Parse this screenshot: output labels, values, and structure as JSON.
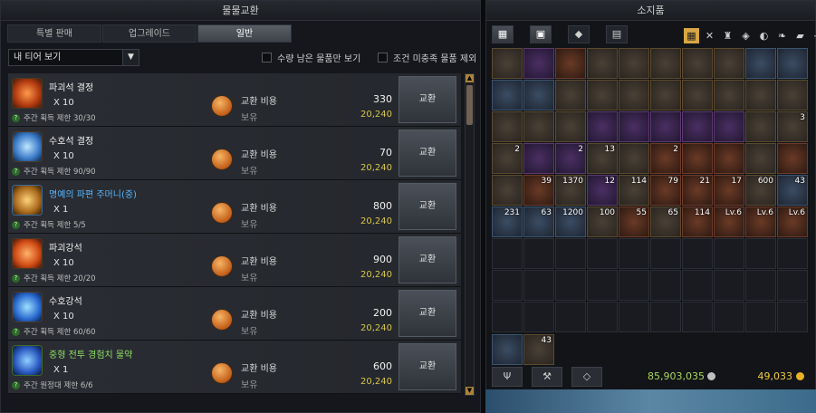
{
  "left_window": {
    "title": "물물교환",
    "tabs": [
      "특별 판매",
      "업그레이드",
      "일반"
    ],
    "active_tab": 2,
    "filter_select": "내 티어 보기",
    "checkbox1": "수량 남은 물품만 보기",
    "checkbox2": "조건 미충족 물품 제외",
    "cost_label": "교환 비용",
    "own_label": "보유",
    "exchange_button": "교환",
    "rows": [
      {
        "name": "파괴석 결정",
        "qty": "X 10",
        "limit": "주간 획득 제한 30/30",
        "cost": "330",
        "own": "20,240",
        "color": "normal"
      },
      {
        "name": "수호석 결정",
        "qty": "X 10",
        "limit": "주간 획득 제한 90/90",
        "cost": "70",
        "own": "20,240",
        "color": "normal"
      },
      {
        "name": "명예의 파편 주머니(중)",
        "qty": "X 1",
        "limit": "주간 획득 제한 5/5",
        "cost": "800",
        "own": "20,240",
        "color": "blue"
      },
      {
        "name": "파괴강석",
        "qty": "X 10",
        "limit": "주간 획득 제한 20/20",
        "cost": "900",
        "own": "20,240",
        "color": "normal"
      },
      {
        "name": "수호강석",
        "qty": "X 10",
        "limit": "주간 획득 제한 60/60",
        "cost": "200",
        "own": "20,240",
        "color": "normal"
      },
      {
        "name": "중형 전투 경험치 물약",
        "qty": "X 1",
        "limit": "주간 원정대 제한 6/6",
        "cost": "600",
        "own": "20,240",
        "color": "green"
      }
    ]
  },
  "right_window": {
    "title": "소지품",
    "silver": "85,903,035",
    "gold": "49,033",
    "counts_row3": [
      "",
      "",
      "",
      "",
      "",
      "",
      "",
      "",
      "",
      "3"
    ],
    "counts_row4": [
      "2",
      "",
      "2",
      "13",
      "",
      "2",
      "",
      "",
      "",
      ""
    ],
    "counts_row5": [
      "",
      "39",
      "1370",
      "12",
      "114",
      "79",
      "21",
      "17",
      "600",
      "43"
    ],
    "counts_row6": [
      "231",
      "63",
      "1200",
      "100",
      "55",
      "65",
      "114",
      "Lv.6",
      "Lv.6",
      "Lv.6"
    ],
    "extra_count": "43"
  }
}
